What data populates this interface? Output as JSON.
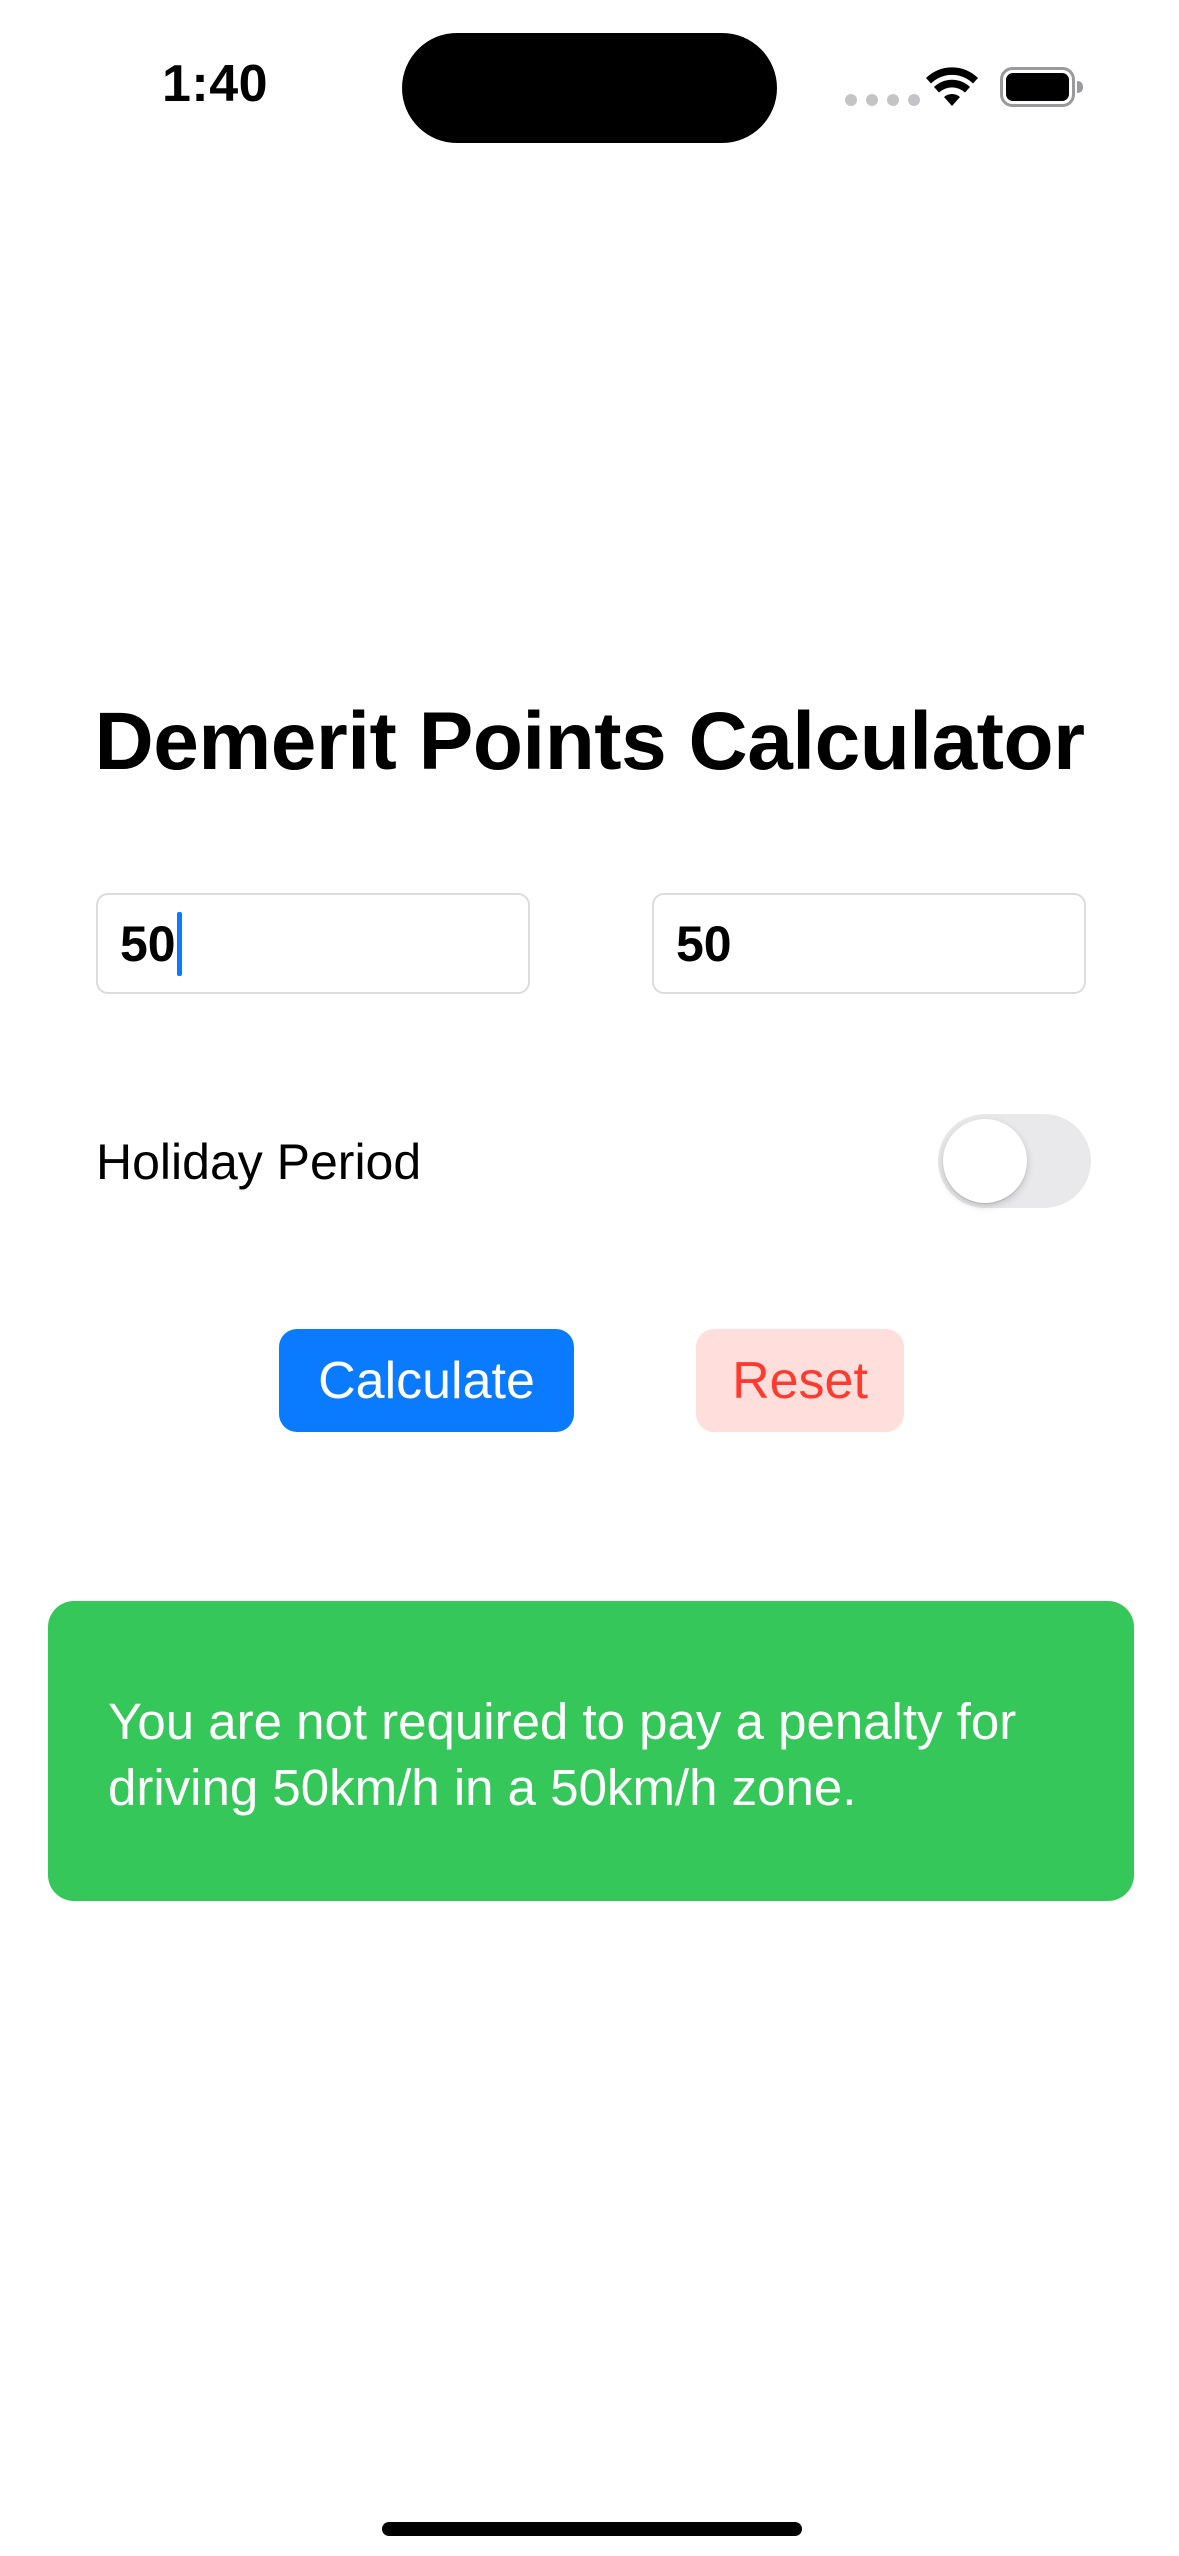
{
  "status_bar": {
    "time": "1:40",
    "icons": [
      "signal-dots-icon",
      "wifi-icon",
      "battery-icon"
    ]
  },
  "title": "Demerit Points Calculator",
  "inputs": {
    "speed_value": "50",
    "limit_value": "50"
  },
  "holiday": {
    "label": "Holiday Period",
    "enabled": false
  },
  "buttons": {
    "calculate": "Calculate",
    "reset": "Reset"
  },
  "result": {
    "message": "You are not required to pay a penalty for driving 50km/h in a 50km/h zone."
  },
  "colors": {
    "accent": "#0a7aff",
    "reset_text": "#ff3b30",
    "reset_bg": "#ffdedc",
    "result_bg": "#36c75a",
    "toggle_off": "#e9e9eb"
  }
}
